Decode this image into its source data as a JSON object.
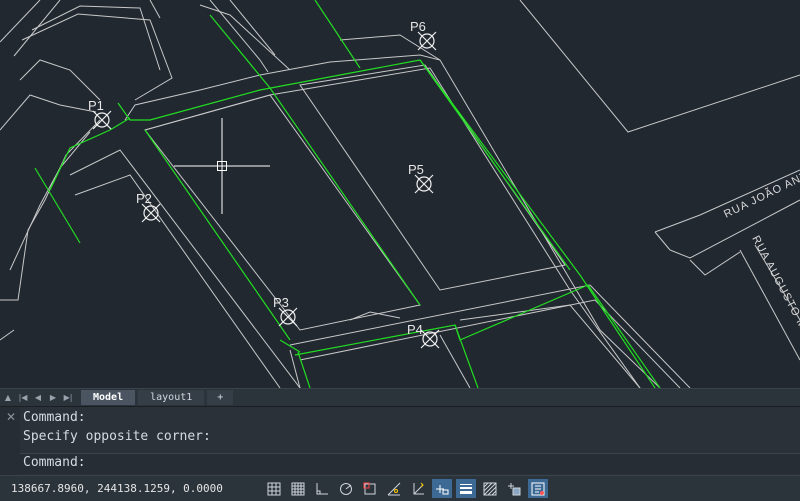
{
  "drawing": {
    "points": [
      {
        "id": "p1",
        "label": "P1"
      },
      {
        "id": "p2",
        "label": "P2"
      },
      {
        "id": "p3",
        "label": "P3"
      },
      {
        "id": "p4",
        "label": "P4"
      },
      {
        "id": "p5",
        "label": "P5"
      },
      {
        "id": "p6",
        "label": "P6"
      }
    ],
    "streets": [
      {
        "id": "rua-joao",
        "label": "RUA JOÃO ANT"
      },
      {
        "id": "rua-augusto",
        "label": "RUA AUGUSTO M"
      }
    ],
    "colors": {
      "background": "#212830",
      "linework": "#c8c8c8",
      "boundary": "#22dd22",
      "crosshair": "#ffffff"
    }
  },
  "tabs": {
    "model": "Model",
    "layout1": "layout1",
    "add": "+"
  },
  "command": {
    "history_1": "Command:",
    "history_2": "Specify opposite corner:",
    "prompt": "Command:",
    "input_value": ""
  },
  "status": {
    "coordinates": "138667.8960, 244138.1259, 0.0000",
    "tools": [
      {
        "icon": "grid-display-icon",
        "active": false
      },
      {
        "icon": "snap-grid-icon",
        "active": false
      },
      {
        "icon": "ortho-icon",
        "active": false
      },
      {
        "icon": "polar-tracking-icon",
        "active": false
      },
      {
        "icon": "object-snap-icon",
        "active": false
      },
      {
        "icon": "object-snap-tracking-icon",
        "active": false
      },
      {
        "icon": "dynamic-ucs-icon",
        "active": false
      },
      {
        "icon": "dynamic-input-icon",
        "active": true
      },
      {
        "icon": "lineweight-icon",
        "active": true
      },
      {
        "icon": "transparency-icon",
        "active": false
      },
      {
        "icon": "selection-cycling-icon",
        "active": false
      },
      {
        "icon": "annotation-monitor-icon",
        "active": true
      }
    ]
  }
}
